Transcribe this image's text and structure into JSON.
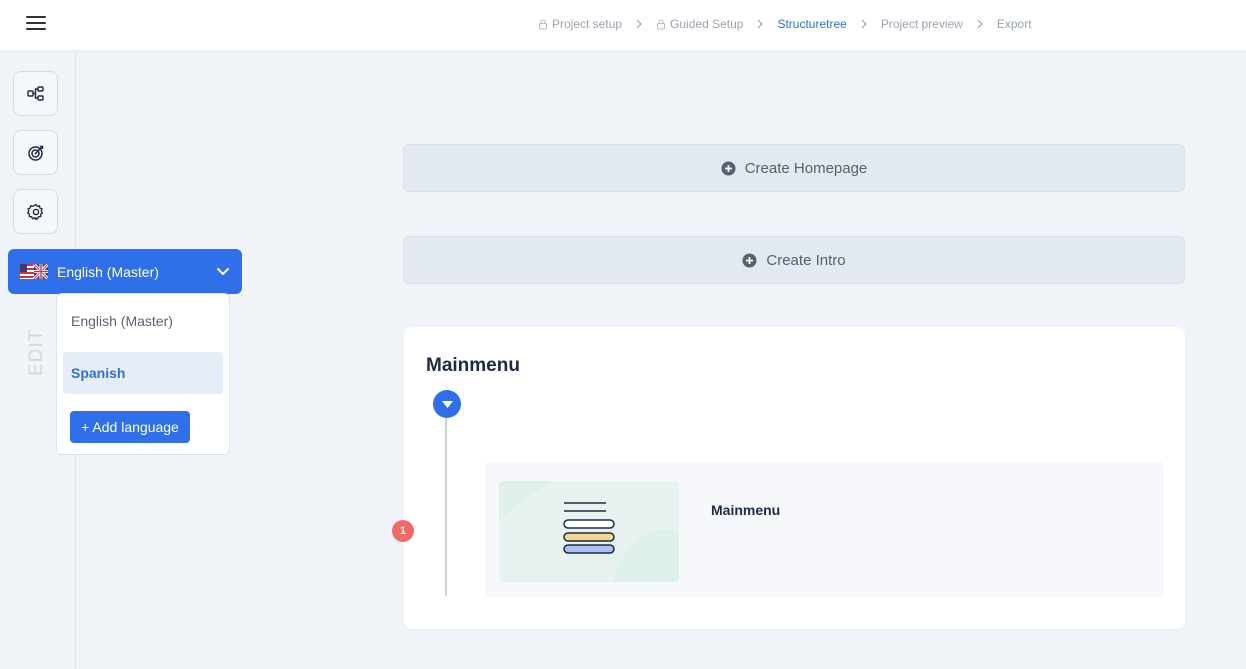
{
  "breadcrumb": [
    {
      "label": "Project setup",
      "locked": true,
      "active": false
    },
    {
      "label": "Guided Setup",
      "locked": true,
      "active": false
    },
    {
      "label": "Structuretree",
      "locked": false,
      "active": true
    },
    {
      "label": "Project preview",
      "locked": false,
      "active": false
    },
    {
      "label": "Export",
      "locked": false,
      "active": false
    }
  ],
  "rail": {
    "buttons": [
      {
        "icon": "sitemap-icon"
      },
      {
        "icon": "target-icon"
      },
      {
        "icon": "gear-icon"
      }
    ],
    "mode_label": "EDIT"
  },
  "language": {
    "selected": "English (Master)",
    "flag_icon": "us-uk-flag-icon",
    "options": [
      "English (Master)",
      "Spanish"
    ],
    "highlighted": "Spanish",
    "add_label": "+ Add language"
  },
  "main": {
    "create_homepage_label": "Create Homepage",
    "create_intro_label": "Create Intro",
    "menu_title": "Mainmenu",
    "badge_count": "1",
    "item_name": "Mainmenu"
  },
  "colors": {
    "accent": "#2f6fe9",
    "badge": "#ef6b67",
    "active_crumb": "#2f6fd6"
  }
}
